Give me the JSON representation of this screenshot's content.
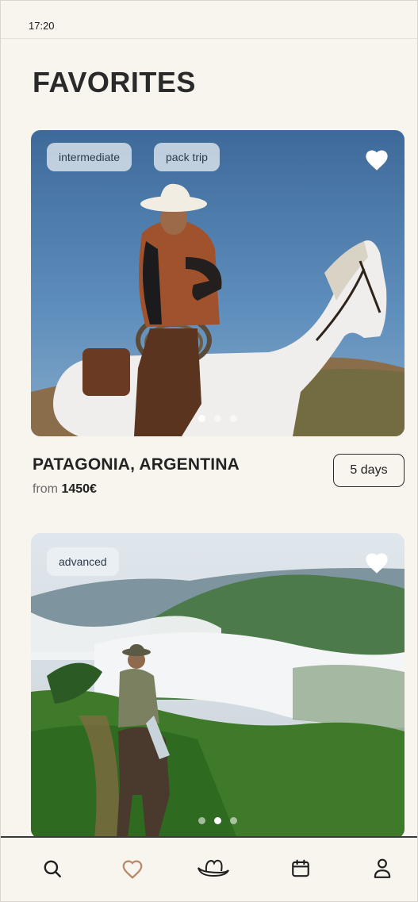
{
  "status_bar": {
    "time": "17:20"
  },
  "page": {
    "title": "FAVORITES"
  },
  "favorites": [
    {
      "tags": [
        "intermediate",
        "pack trip"
      ],
      "favorited": true,
      "image_subject": "rider in cowboy hat on white horse under blue sky",
      "dots": 3,
      "active_dot": 0,
      "title": "PATAGONIA, ARGENTINA",
      "price_prefix": "from",
      "price": "1450€",
      "duration": "5 days"
    },
    {
      "tags": [
        "advanced"
      ],
      "favorited": true,
      "image_subject": "rider on mule on green mountain trail above clouds",
      "dots": 3,
      "active_dot": 1
    }
  ],
  "tab_bar": {
    "items": [
      {
        "icon": "search-icon",
        "active": false
      },
      {
        "icon": "heart-icon",
        "active": true
      },
      {
        "icon": "cowboy-hat-icon",
        "active": false
      },
      {
        "icon": "calendar-icon",
        "active": false
      },
      {
        "icon": "profile-icon",
        "active": false
      }
    ],
    "active_color": "#b58a6a",
    "inactive_color": "#1f1f1f"
  }
}
